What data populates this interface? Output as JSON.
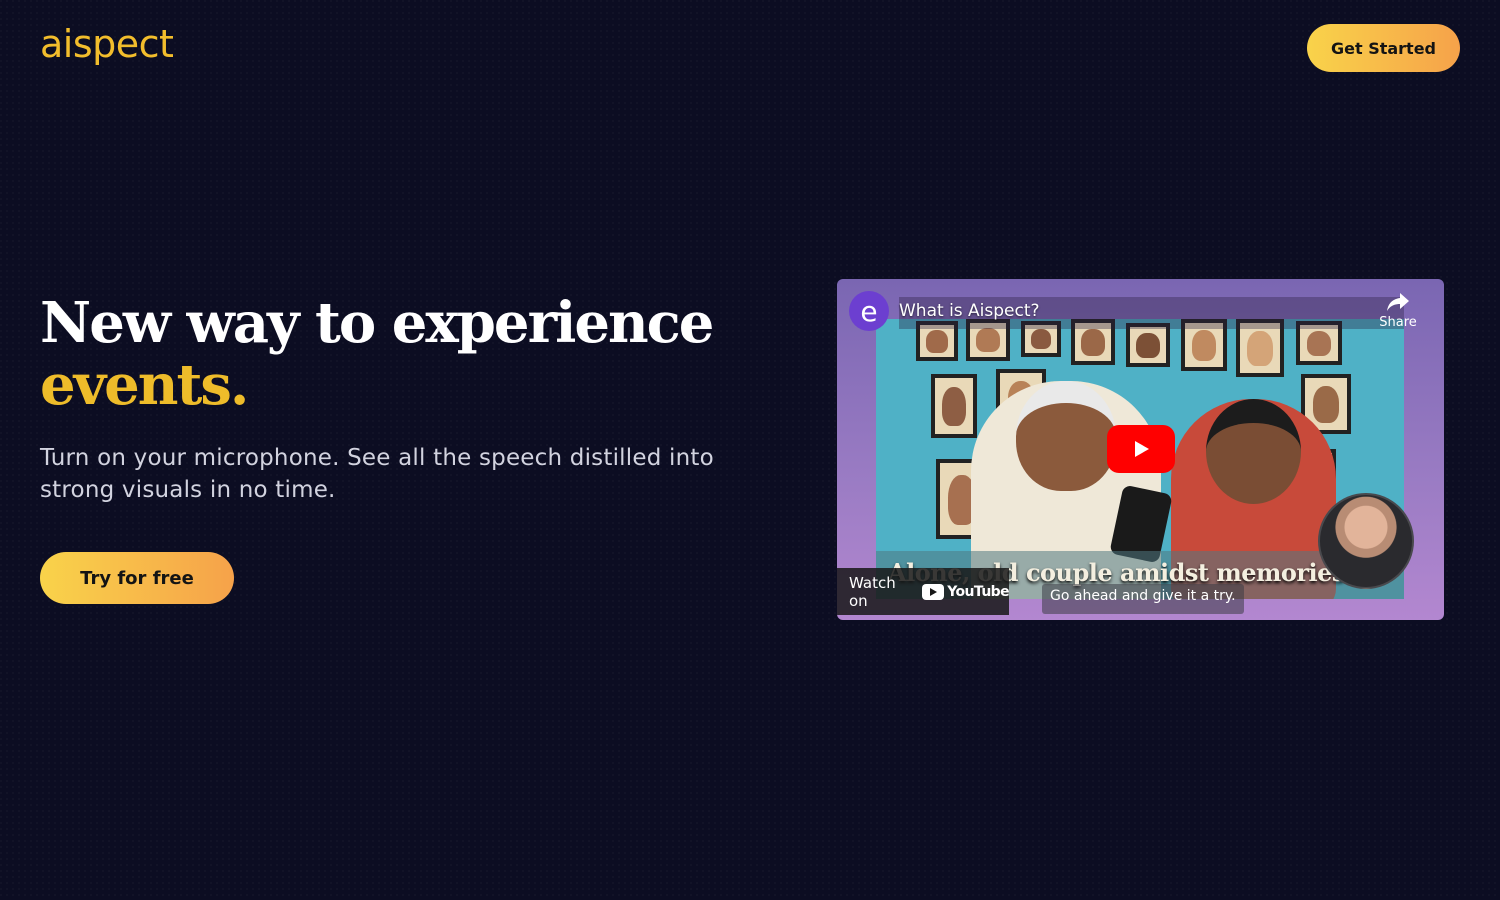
{
  "brand": {
    "logo_text": "aispect",
    "accent": "#f2bd2c"
  },
  "header": {
    "cta_label": "Get Started"
  },
  "hero": {
    "headline_line1": "New way to experience",
    "headline_accent": "events.",
    "subtext": "Turn on your microphone. See all the speech distilled into strong visuals in no time.",
    "cta_label": "Try for free"
  },
  "video": {
    "channel_initial": "e",
    "title": "What is Aispect?",
    "share_label": "Share",
    "caption_main": "Alone, old couple amidst memories.",
    "caption_sub": "Go ahead and give it a try.",
    "watch_on_label": "Watch on",
    "youtube_label": "YouTube",
    "icons": [
      "share-icon",
      "play-icon",
      "youtube-icon"
    ]
  }
}
